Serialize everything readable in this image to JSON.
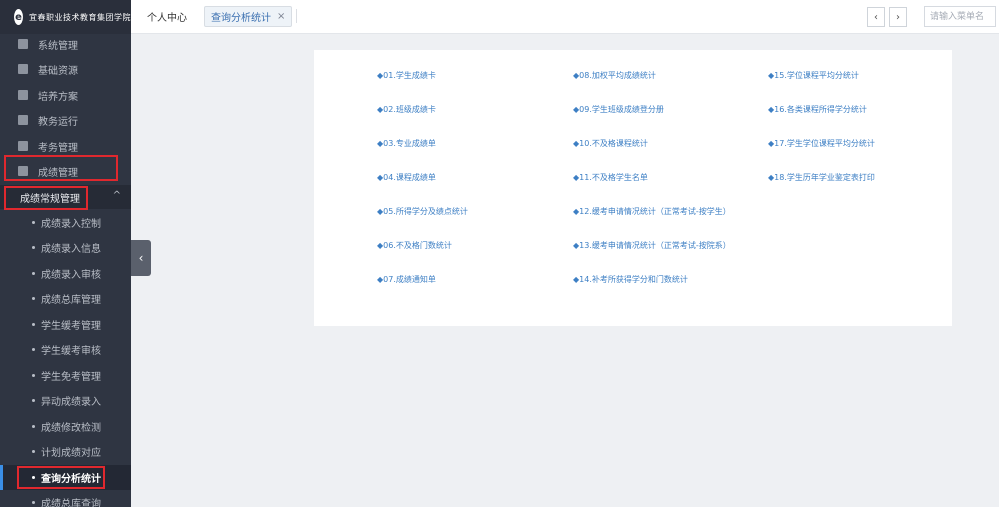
{
  "logo": {
    "text": "宜春职业技术教育集团学院"
  },
  "sidebar": {
    "menus": [
      {
        "label": "系统管理",
        "icon": "grid-icon"
      },
      {
        "label": "基础资源",
        "icon": "flag-icon"
      },
      {
        "label": "培养方案",
        "icon": "book-icon"
      },
      {
        "label": "教务运行",
        "icon": "document-icon"
      },
      {
        "label": "考务管理",
        "icon": "users-icon"
      },
      {
        "label": "成绩管理",
        "icon": "briefcase-icon"
      }
    ],
    "group": {
      "label": "成绩常规管理",
      "chevron": "^"
    },
    "subitems": [
      "成绩录入控制",
      "成绩录入信息",
      "成绩录入审核",
      "成绩总库管理",
      "学生缓考管理",
      "学生缓考审核",
      "学生免考管理",
      "异动成绩录入",
      "成绩修改检测",
      "计划成绩对应",
      "查询分析统计",
      "成绩总库查询"
    ],
    "active_subitem": "查询分析统计",
    "collapse_glyph": "‹"
  },
  "topbar": {
    "home_tab": "个人中心",
    "active_tab": "查询分析统计",
    "close_glyph": "×",
    "prev_glyph": "‹",
    "next_glyph": "›",
    "search_placeholder": "请输入菜单名"
  },
  "reports": {
    "col1": [
      "◆01.学生成绩卡",
      "◆02.班级成绩卡",
      "◆03.专业成绩单",
      "◆04.课程成绩单",
      "◆05.所得学分及绩点统计",
      "◆06.不及格门数统计",
      "◆07.成绩通知单"
    ],
    "col2": [
      "◆08.加权平均成绩统计",
      "◆09.学生班级成绩登分册",
      "◆10.不及格课程统计",
      "◆11.不及格学生名单",
      "◆12.缓考申请情况统计（正常考试-按学生）",
      "◆13.缓考申请情况统计（正常考试-按院系）",
      "◆14.补考所获得学分和门数统计"
    ],
    "col3": [
      "◆15.学位课程平均分统计",
      "◆16.各类课程所得学分统计",
      "◆17.学生学位课程平均分统计",
      "◆18.学生历年学业鉴定表打印"
    ]
  },
  "colors": {
    "sidebar_bg": "#2f3542",
    "link": "#3d7fc4",
    "highlight": "#e0282e",
    "active_accent": "#3a8ee6"
  }
}
